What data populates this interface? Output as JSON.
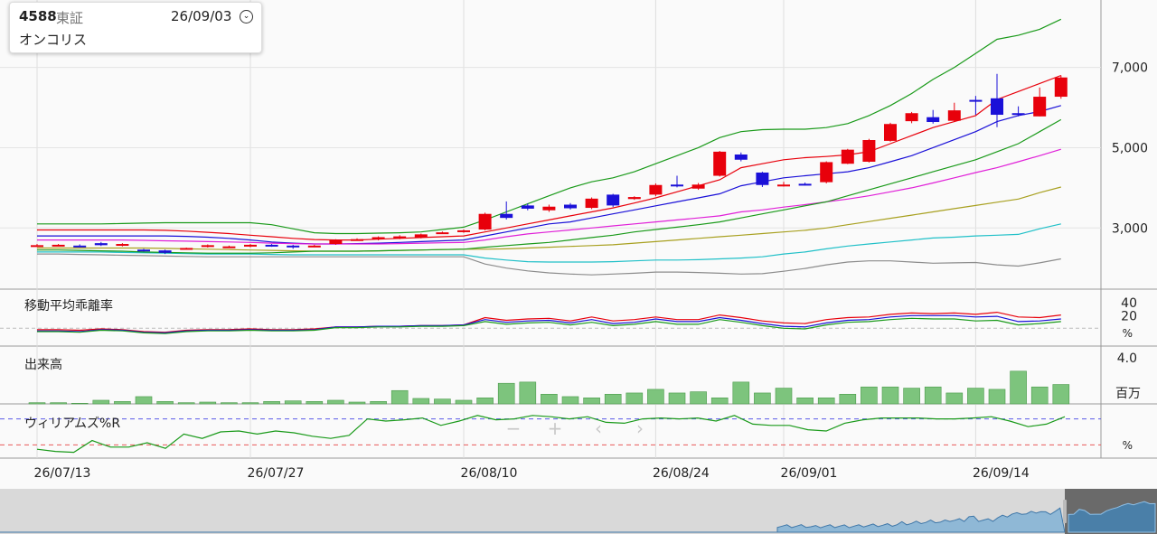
{
  "stock": {
    "code": "4588",
    "market": "東証",
    "date": "26/09/03",
    "name": "オンコリス"
  },
  "colors": {
    "up": "#e8000b",
    "down": "#1a10d8",
    "ma_short": "#e8000b",
    "ma_mid": "#1a10d8",
    "ma_long": "#e020d8",
    "ma_olive": "#a8a020",
    "ma_cyan": "#20c0c8",
    "ma_gray": "#8c8c8c",
    "band": "#1a9a1a",
    "volume": "#7dc47d"
  },
  "chart_data": [
    {
      "name": "price",
      "type": "candlestick",
      "x": [
        "26/07/13",
        "26/07/14",
        "26/07/15",
        "26/07/16",
        "26/07/17",
        "26/07/20",
        "26/07/21",
        "26/07/22",
        "26/07/23",
        "26/07/24",
        "26/07/27",
        "26/07/28",
        "26/07/29",
        "26/07/30",
        "26/07/31",
        "26/08/03",
        "26/08/04",
        "26/08/05",
        "26/08/06",
        "26/08/07",
        "26/08/10",
        "26/08/11",
        "26/08/12",
        "26/08/13",
        "26/08/14",
        "26/08/17",
        "26/08/18",
        "26/08/19",
        "26/08/20",
        "26/08/21",
        "26/08/24",
        "26/08/25",
        "26/08/26",
        "26/08/27",
        "26/08/28",
        "26/08/31",
        "26/09/01",
        "26/09/02",
        "26/09/03",
        "26/09/04",
        "26/09/07",
        "26/09/08",
        "26/09/09",
        "26/09/10",
        "26/09/11",
        "26/09/14",
        "26/09/15",
        "26/09/16",
        "26/09/17",
        "26/09/18"
      ],
      "open": [
        2570,
        2570,
        2560,
        2620,
        2600,
        2460,
        2440,
        2490,
        2530,
        2530,
        2540,
        2580,
        2560,
        2530,
        2600,
        2700,
        2720,
        2740,
        2760,
        2860,
        2910,
        2960,
        3350,
        3560,
        3440,
        3580,
        3500,
        3830,
        3720,
        3830,
        4080,
        3980,
        4300,
        4830,
        4380,
        4060,
        4100,
        4140,
        4600,
        4650,
        5170,
        5660,
        5760,
        5670,
        6190,
        6230,
        5860,
        5780,
        6270
      ],
      "close": [
        2570,
        2580,
        2540,
        2570,
        2600,
        2420,
        2380,
        2500,
        2570,
        2540,
        2580,
        2550,
        2520,
        2560,
        2700,
        2720,
        2770,
        2790,
        2840,
        2890,
        2940,
        3350,
        3250,
        3480,
        3530,
        3490,
        3730,
        3560,
        3770,
        4070,
        4040,
        4080,
        4900,
        4700,
        4070,
        4080,
        4090,
        4640,
        4950,
        5190,
        5590,
        5860,
        5640,
        5930,
        6180,
        5820,
        5840,
        6270,
        6750
      ],
      "high": [
        2600,
        2600,
        2590,
        2650,
        2620,
        2480,
        2460,
        2510,
        2590,
        2560,
        2600,
        2600,
        2580,
        2580,
        2720,
        2740,
        2790,
        2820,
        2860,
        2910,
        2960,
        3380,
        3660,
        3610,
        3580,
        3620,
        3760,
        3850,
        3790,
        4110,
        4300,
        4120,
        4920,
        4880,
        4400,
        4150,
        4130,
        4660,
        4970,
        5220,
        5620,
        5890,
        5940,
        6120,
        6290,
        6840,
        6030,
        6500,
        6800
      ],
      "low": [
        2550,
        2550,
        2520,
        2550,
        2540,
        2410,
        2350,
        2470,
        2510,
        2510,
        2520,
        2530,
        2480,
        2520,
        2580,
        2690,
        2690,
        2720,
        2740,
        2850,
        2880,
        2940,
        3210,
        3440,
        3400,
        3460,
        3470,
        3520,
        3700,
        3790,
        4010,
        3950,
        4280,
        4660,
        4020,
        4030,
        4060,
        4110,
        4590,
        4630,
        5150,
        5610,
        5600,
        5640,
        5820,
        5510,
        5780,
        5780,
        6220
      ],
      "ylim": [
        1700,
        8500
      ],
      "yticks": [
        "3,000",
        "5,000",
        "7,000"
      ],
      "series": [
        {
          "name": "ma_short",
          "values": [
            2950,
            2950,
            2950,
            2950,
            2950,
            2950,
            2940,
            2920,
            2890,
            2860,
            2820,
            2780,
            2740,
            2710,
            2700,
            2700,
            2720,
            2740,
            2760,
            2780,
            2800,
            2900,
            3000,
            3100,
            3200,
            3300,
            3400,
            3500,
            3620,
            3750,
            3900,
            4050,
            4200,
            4500,
            4600,
            4700,
            4750,
            4780,
            4820,
            4900,
            5100,
            5300,
            5500,
            5650,
            5800,
            6200,
            6400,
            6600,
            6800
          ]
        },
        {
          "name": "ma_mid",
          "values": [
            2800,
            2800,
            2800,
            2800,
            2800,
            2800,
            2800,
            2790,
            2770,
            2740,
            2700,
            2650,
            2620,
            2600,
            2600,
            2610,
            2620,
            2640,
            2660,
            2680,
            2700,
            2800,
            2900,
            3000,
            3100,
            3150,
            3250,
            3350,
            3450,
            3550,
            3650,
            3750,
            3850,
            4050,
            4150,
            4250,
            4300,
            4350,
            4400,
            4500,
            4650,
            4800,
            5000,
            5200,
            5400,
            5650,
            5800,
            5900,
            6050
          ]
        },
        {
          "name": "ma_long",
          "values": [
            2700,
            2700,
            2700,
            2700,
            2700,
            2690,
            2680,
            2670,
            2660,
            2650,
            2640,
            2620,
            2610,
            2600,
            2600,
            2600,
            2600,
            2610,
            2620,
            2630,
            2640,
            2700,
            2780,
            2850,
            2900,
            2950,
            3000,
            3050,
            3100,
            3150,
            3200,
            3250,
            3300,
            3400,
            3450,
            3520,
            3580,
            3650,
            3720,
            3800,
            3900,
            4000,
            4120,
            4250,
            4380,
            4500,
            4650,
            4800,
            4960
          ]
        },
        {
          "name": "ma_olive",
          "values": [
            2500,
            2500,
            2500,
            2500,
            2500,
            2500,
            2490,
            2480,
            2470,
            2460,
            2450,
            2440,
            2430,
            2420,
            2420,
            2420,
            2430,
            2440,
            2450,
            2460,
            2470,
            2470,
            2480,
            2500,
            2520,
            2540,
            2560,
            2580,
            2620,
            2660,
            2700,
            2740,
            2780,
            2820,
            2860,
            2900,
            2940,
            3000,
            3080,
            3160,
            3240,
            3320,
            3400,
            3480,
            3560,
            3640,
            3720,
            3880,
            4020
          ]
        },
        {
          "name": "ma_cyan",
          "values": [
            2400,
            2400,
            2400,
            2400,
            2390,
            2380,
            2370,
            2360,
            2350,
            2350,
            2350,
            2340,
            2330,
            2330,
            2330,
            2330,
            2330,
            2330,
            2330,
            2330,
            2330,
            2250,
            2200,
            2160,
            2150,
            2150,
            2150,
            2160,
            2180,
            2200,
            2200,
            2210,
            2230,
            2250,
            2280,
            2350,
            2400,
            2480,
            2550,
            2600,
            2650,
            2700,
            2750,
            2770,
            2800,
            2820,
            2840,
            2980,
            3100
          ]
        },
        {
          "name": "ma_gray",
          "values": [
            2350,
            2350,
            2340,
            2330,
            2320,
            2310,
            2300,
            2290,
            2280,
            2280,
            2280,
            2280,
            2280,
            2280,
            2280,
            2280,
            2280,
            2280,
            2280,
            2280,
            2280,
            2100,
            2000,
            1930,
            1880,
            1850,
            1830,
            1850,
            1870,
            1900,
            1900,
            1890,
            1870,
            1850,
            1860,
            1920,
            1990,
            2080,
            2150,
            2180,
            2180,
            2150,
            2120,
            2130,
            2140,
            2080,
            2050,
            2130,
            2230
          ]
        },
        {
          "name": "band_upper",
          "values": [
            3100,
            3100,
            3100,
            3100,
            3110,
            3120,
            3130,
            3130,
            3130,
            3130,
            3130,
            3080,
            2980,
            2880,
            2860,
            2860,
            2870,
            2880,
            2900,
            2960,
            3020,
            3200,
            3400,
            3600,
            3800,
            4000,
            4150,
            4250,
            4400,
            4600,
            4800,
            5000,
            5250,
            5400,
            5450,
            5460,
            5460,
            5500,
            5600,
            5800,
            6050,
            6350,
            6700,
            7000,
            7350,
            7700,
            7800,
            7950,
            8200
          ]
        },
        {
          "name": "band_lower",
          "values": [
            2450,
            2450,
            2440,
            2430,
            2420,
            2400,
            2390,
            2380,
            2370,
            2370,
            2370,
            2380,
            2400,
            2420,
            2420,
            2420,
            2430,
            2440,
            2450,
            2460,
            2470,
            2520,
            2560,
            2600,
            2640,
            2700,
            2760,
            2820,
            2900,
            2960,
            3020,
            3080,
            3150,
            3250,
            3350,
            3450,
            3550,
            3650,
            3800,
            3950,
            4100,
            4250,
            4400,
            4550,
            4700,
            4900,
            5100,
            5400,
            5700
          ]
        }
      ]
    },
    {
      "name": "deviation",
      "label": "移動平均乖離率",
      "yticks": [
        "40",
        "20"
      ],
      "unit": "%",
      "ylim": [
        -20,
        48
      ],
      "series": [
        {
          "name": "dev_short",
          "values": [
            -2,
            -2,
            -3,
            -1,
            -2,
            -5,
            -6,
            -3,
            -2,
            -2,
            -1,
            -2,
            -2,
            -1,
            2,
            2,
            3,
            3,
            4,
            4,
            5,
            16,
            12,
            14,
            15,
            11,
            17,
            11,
            13,
            17,
            13,
            13,
            20,
            16,
            11,
            8,
            7,
            13,
            16,
            17,
            21,
            23,
            22,
            23,
            21,
            24,
            17,
            16,
            20
          ]
        },
        {
          "name": "dev_mid",
          "values": [
            -4,
            -4,
            -5,
            -2,
            -3,
            -6,
            -7,
            -4,
            -3,
            -3,
            -2,
            -3,
            -3,
            -2,
            2,
            2,
            3,
            3,
            4,
            4,
            5,
            13,
            9,
            11,
            12,
            8,
            13,
            7,
            9,
            14,
            10,
            10,
            16,
            12,
            7,
            3,
            2,
            8,
            12,
            13,
            17,
            19,
            19,
            19,
            17,
            18,
            10,
            11,
            14
          ]
        },
        {
          "name": "dev_long",
          "values": [
            -5,
            -5,
            -6,
            -3,
            -4,
            -7,
            -8,
            -5,
            -4,
            -4,
            -3,
            -4,
            -4,
            -3,
            1,
            1,
            2,
            2,
            3,
            3,
            4,
            10,
            6,
            8,
            9,
            5,
            9,
            4,
            6,
            10,
            6,
            6,
            13,
            9,
            4,
            0,
            -1,
            5,
            9,
            10,
            13,
            15,
            14,
            14,
            11,
            12,
            5,
            7,
            10
          ]
        }
      ]
    },
    {
      "name": "volume",
      "label": "出来高",
      "ytick": "4.0",
      "unit": "百万",
      "ylim": [
        0,
        4.4
      ],
      "values": [
        0.1,
        0.1,
        0.05,
        0.3,
        0.2,
        0.6,
        0.2,
        0.1,
        0.15,
        0.1,
        0.1,
        0.2,
        0.25,
        0.2,
        0.3,
        0.15,
        0.2,
        1.1,
        0.45,
        0.4,
        0.3,
        0.5,
        1.7,
        1.8,
        0.8,
        0.6,
        0.5,
        0.8,
        0.9,
        1.2,
        0.9,
        1.0,
        0.5,
        1.8,
        0.9,
        1.3,
        0.5,
        0.5,
        0.8,
        1.4,
        1.4,
        1.3,
        1.4,
        0.9,
        1.3,
        1.2,
        2.7,
        1.4,
        1.6
      ]
    },
    {
      "name": "williams",
      "label": "ウィリアムズ%R",
      "unit": "%",
      "ylim": [
        -100,
        0
      ],
      "ref_levels": [
        -20,
        -80
      ],
      "values": [
        -90,
        -95,
        -97,
        -70,
        -85,
        -85,
        -75,
        -88,
        -55,
        -65,
        -50,
        -48,
        -55,
        -48,
        -52,
        -60,
        -65,
        -58,
        -20,
        -25,
        -22,
        -18,
        -35,
        -25,
        -12,
        -22,
        -20,
        -12,
        -15,
        -20,
        -15,
        -28,
        -30,
        -20,
        -18,
        -20,
        -18,
        -25,
        -12,
        -32,
        -35,
        -35,
        -45,
        -48,
        -30,
        -22,
        -18,
        -18,
        -18,
        -20,
        -20,
        -18,
        -15,
        -25,
        -38,
        -32,
        -15
      ]
    }
  ],
  "x_axis_labels": [
    {
      "index": 0,
      "label": "26/07/13"
    },
    {
      "index": 10,
      "label": "26/07/27"
    },
    {
      "index": 20,
      "label": "26/08/10"
    },
    {
      "index": 29,
      "label": "26/08/24"
    },
    {
      "index": 35,
      "label": "26/09/01"
    },
    {
      "index": 44,
      "label": "26/09/14"
    }
  ],
  "zoom_controls": {
    "minus": "−",
    "plus": "+",
    "prev": "‹",
    "next": "›"
  }
}
